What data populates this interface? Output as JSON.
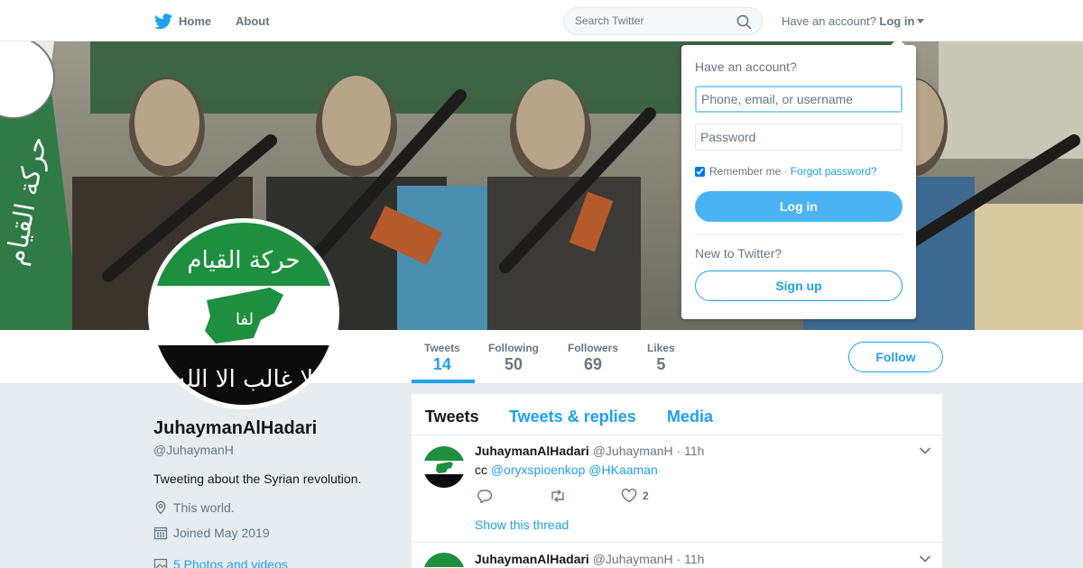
{
  "nav": {
    "home_label": "Home",
    "about_label": "About",
    "search_placeholder": "Search Twitter",
    "have_account_label": "Have an account?",
    "login_label": "Log in",
    "brand_color": "#1da1f2"
  },
  "profile": {
    "name": "JuhaymanAlHadari",
    "handle": "@JuhaymanH",
    "bio": "Tweeting about the Syrian revolution.",
    "location": "This world.",
    "joined": "Joined May 2019",
    "photos_link": "5 Photos and videos",
    "follow_label": "Follow",
    "avatar_text_top": "حركة القيام",
    "avatar_text_bottom": "لا غالب الا الله",
    "avatar_map_text": "لفا"
  },
  "stats": [
    {
      "label": "Tweets",
      "value": "14"
    },
    {
      "label": "Following",
      "value": "50"
    },
    {
      "label": "Followers",
      "value": "69"
    },
    {
      "label": "Likes",
      "value": "5"
    }
  ],
  "timeline": {
    "tabs": [
      "Tweets",
      "Tweets & replies",
      "Media"
    ],
    "tweets": [
      {
        "name": "JuhaymanAlHadari",
        "handle": "@JuhaymanH",
        "time": "· 11h",
        "text_prefix": "cc",
        "mention1": "@oryxspioenkop",
        "mention2": "@HKaaman",
        "like_count": "2",
        "show_thread": "Show this thread"
      },
      {
        "name": "JuhaymanAlHadari",
        "handle": "@JuhaymanH",
        "time": "· 11h"
      }
    ]
  },
  "login_dropdown": {
    "title": "Have an account?",
    "username_placeholder": "Phone, email, or username",
    "password_placeholder": "Password",
    "remember_label": "Remember me ·",
    "forgot_label": "Forgot password?",
    "login_button": "Log in",
    "new_label": "New to Twitter?",
    "signup_button": "Sign up"
  },
  "banner": {
    "flag_text": "حركة القيام"
  }
}
